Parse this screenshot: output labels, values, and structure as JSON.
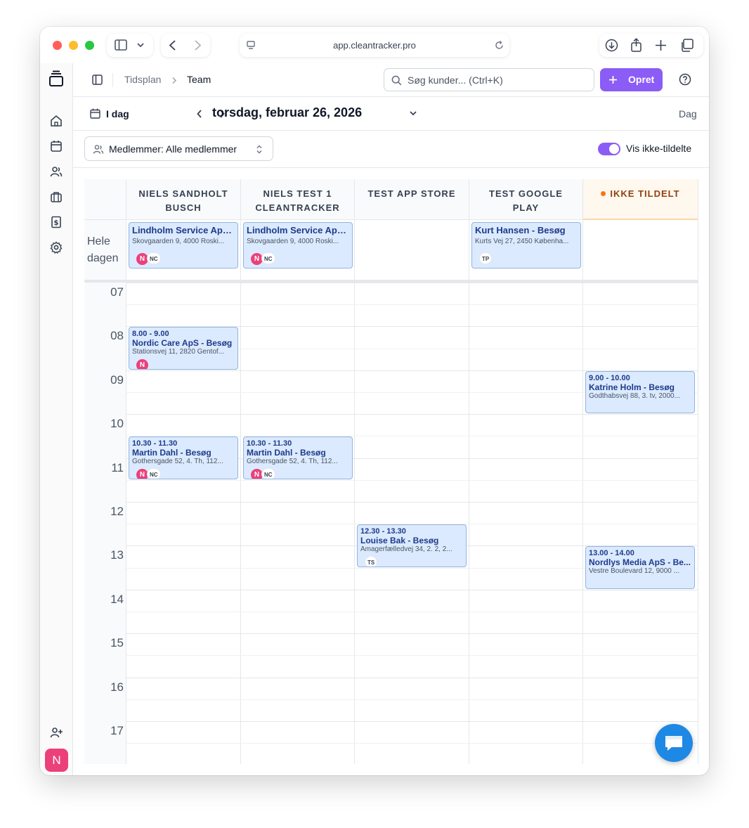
{
  "browser": {
    "url": "app.cleantracker.pro"
  },
  "header": {
    "breadcrumb_root": "Tidsplan",
    "breadcrumb_current": "Team",
    "search_placeholder": "Søg kunder... (Ctrl+K)",
    "create_label": "Opret"
  },
  "toolbar": {
    "today_label": "I dag",
    "date_title": "torsdag, februar 26, 2026",
    "view_label": "Dag"
  },
  "filters": {
    "members_label": "Medlemmer: Alle medlemmer",
    "toggle_label": "Vis ikke-tildelte",
    "toggle_on": true
  },
  "calendar": {
    "allday_label_1": "Hele",
    "allday_label_2": "dagen",
    "columns": [
      {
        "line1": "NIELS SANDHOLT",
        "line2": "BUSCH"
      },
      {
        "line1": "NIELS TEST 1",
        "line2": "CLEANTRACKER"
      },
      {
        "line1": "TEST APP STORE",
        "line2": ""
      },
      {
        "line1": "TEST GOOGLE",
        "line2": "PLAY"
      },
      {
        "line1": "IKKE TILDELT",
        "line2": ""
      }
    ],
    "hours": [
      "07",
      "08",
      "09",
      "10",
      "11",
      "12",
      "13",
      "14",
      "15",
      "16",
      "17"
    ],
    "allday_events": [
      {
        "col": 0,
        "title": "Lindholm Service ApS...",
        "address": "Skovgaarden 9, 4000 Roski...",
        "avatars": [
          "N",
          "NC"
        ]
      },
      {
        "col": 1,
        "title": "Lindholm Service ApS...",
        "address": "Skovgaarden 9, 4000 Roski...",
        "avatars": [
          "N",
          "NC"
        ]
      },
      {
        "col": 3,
        "title": "Kurt Hansen - Besøg",
        "address": "Kurts Vej 27, 2450 Københa...",
        "avatars": [
          "TP"
        ]
      }
    ],
    "events": [
      {
        "col": 0,
        "start": 8.0,
        "end": 9.0,
        "time": "8.00 - 9.00",
        "title": "Nordic Care ApS - Besøg",
        "address": "Stationsvej 11, 2820 Gentof...",
        "avatars": [
          "N"
        ]
      },
      {
        "col": 4,
        "start": 9.0,
        "end": 10.0,
        "time": "9.00 - 10.00",
        "title": "Katrine Holm - Besøg",
        "address": "Godthabsvej 88, 3. tv, 2000...",
        "avatars": []
      },
      {
        "col": 0,
        "start": 10.5,
        "end": 11.5,
        "time": "10.30 - 11.30",
        "title": "Martin Dahl - Besøg",
        "address": "Gothersgade 52, 4. Th, 112...",
        "avatars": [
          "N",
          "NC"
        ]
      },
      {
        "col": 1,
        "start": 10.5,
        "end": 11.5,
        "time": "10.30 - 11.30",
        "title": "Martin Dahl - Besøg",
        "address": "Gothersgade 52, 4. Th, 112...",
        "avatars": [
          "N",
          "NC"
        ]
      },
      {
        "col": 2,
        "start": 12.5,
        "end": 13.5,
        "time": "12.30 - 13.30",
        "title": "Louise Bak - Besøg",
        "address": "Amagerfælledvej 34, 2. 2, 2...",
        "avatars": [
          "TS"
        ]
      },
      {
        "col": 4,
        "start": 13.0,
        "end": 14.0,
        "time": "13.00 - 14.00",
        "title": "Nordlys Media ApS - Be...",
        "address": "Vestre Boulevard 12, 9000 ...",
        "avatars": []
      }
    ]
  },
  "user": {
    "avatar_initial": "N"
  },
  "colors": {
    "accent": "#8b5cf6",
    "event_bg": "#dbeafe",
    "avatar_pink": "#ec407a",
    "unassigned_dot": "#f97316"
  }
}
